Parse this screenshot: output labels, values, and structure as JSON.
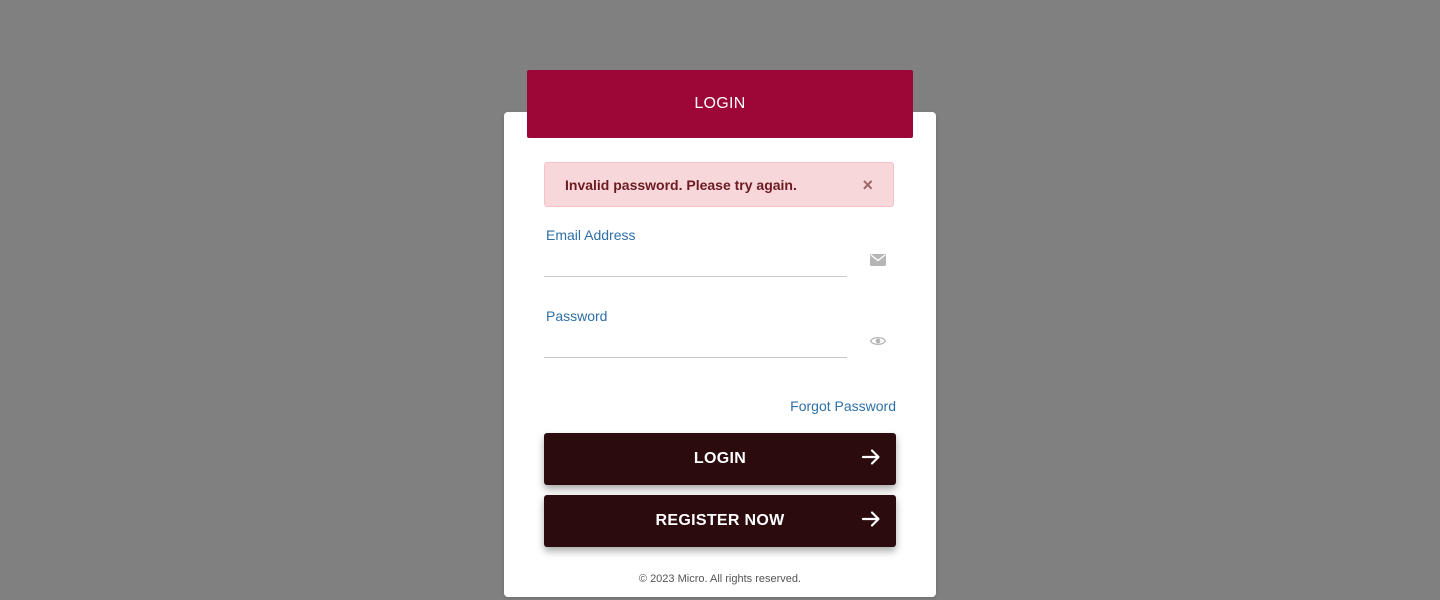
{
  "header": {
    "title": "LOGIN"
  },
  "alert": {
    "message": "Invalid password. Please try again.",
    "close_symbol": "×"
  },
  "email": {
    "label": "Email Address",
    "value": "",
    "icon": "envelope-icon"
  },
  "password": {
    "label": "Password",
    "value": "",
    "icon": "eye-icon"
  },
  "forgot_password": "Forgot Password",
  "buttons": {
    "login_label": "LOGIN",
    "register_label": "REGISTER NOW"
  },
  "footer": {
    "text": "© 2023 Micro. All rights reserved."
  },
  "colors": {
    "background": "#808080",
    "header": "#9d0737",
    "button": "#2b0b0e",
    "alert_bg": "#f8d7da",
    "label": "#2e6fa8"
  }
}
